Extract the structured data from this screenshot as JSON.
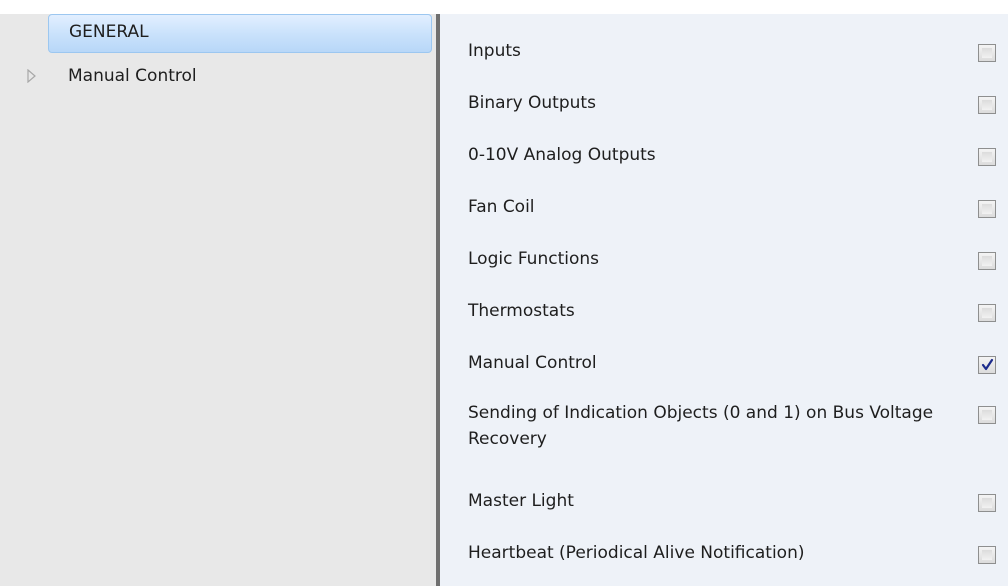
{
  "tree": {
    "items": [
      {
        "label": "GENERAL",
        "selected": true
      },
      {
        "label": "Manual Control",
        "selected": false,
        "expandable": true
      }
    ]
  },
  "parameters": {
    "rows": [
      {
        "label": "Inputs",
        "checked": false
      },
      {
        "label": "Binary Outputs",
        "checked": false
      },
      {
        "label": "0-10V Analog Outputs",
        "checked": false
      },
      {
        "label": "Fan Coil",
        "checked": false
      },
      {
        "label": "Logic Functions",
        "checked": false
      },
      {
        "label": "Thermostats",
        "checked": false
      },
      {
        "label": "Manual Control",
        "checked": true
      },
      {
        "label": "Sending of Indication Objects (0 and 1) on Bus Voltage Recovery",
        "checked": false
      },
      {
        "label": "Master Light",
        "checked": false
      },
      {
        "label": "Heartbeat (Periodical Alive Notification)",
        "checked": false
      }
    ]
  },
  "colors": {
    "tree_background": "#e8e8e8",
    "selection": "#c8e1fb",
    "panel_background": "#eef2f8",
    "splitter": "#6f6f6f",
    "checkmark": "#1c2b8c"
  }
}
